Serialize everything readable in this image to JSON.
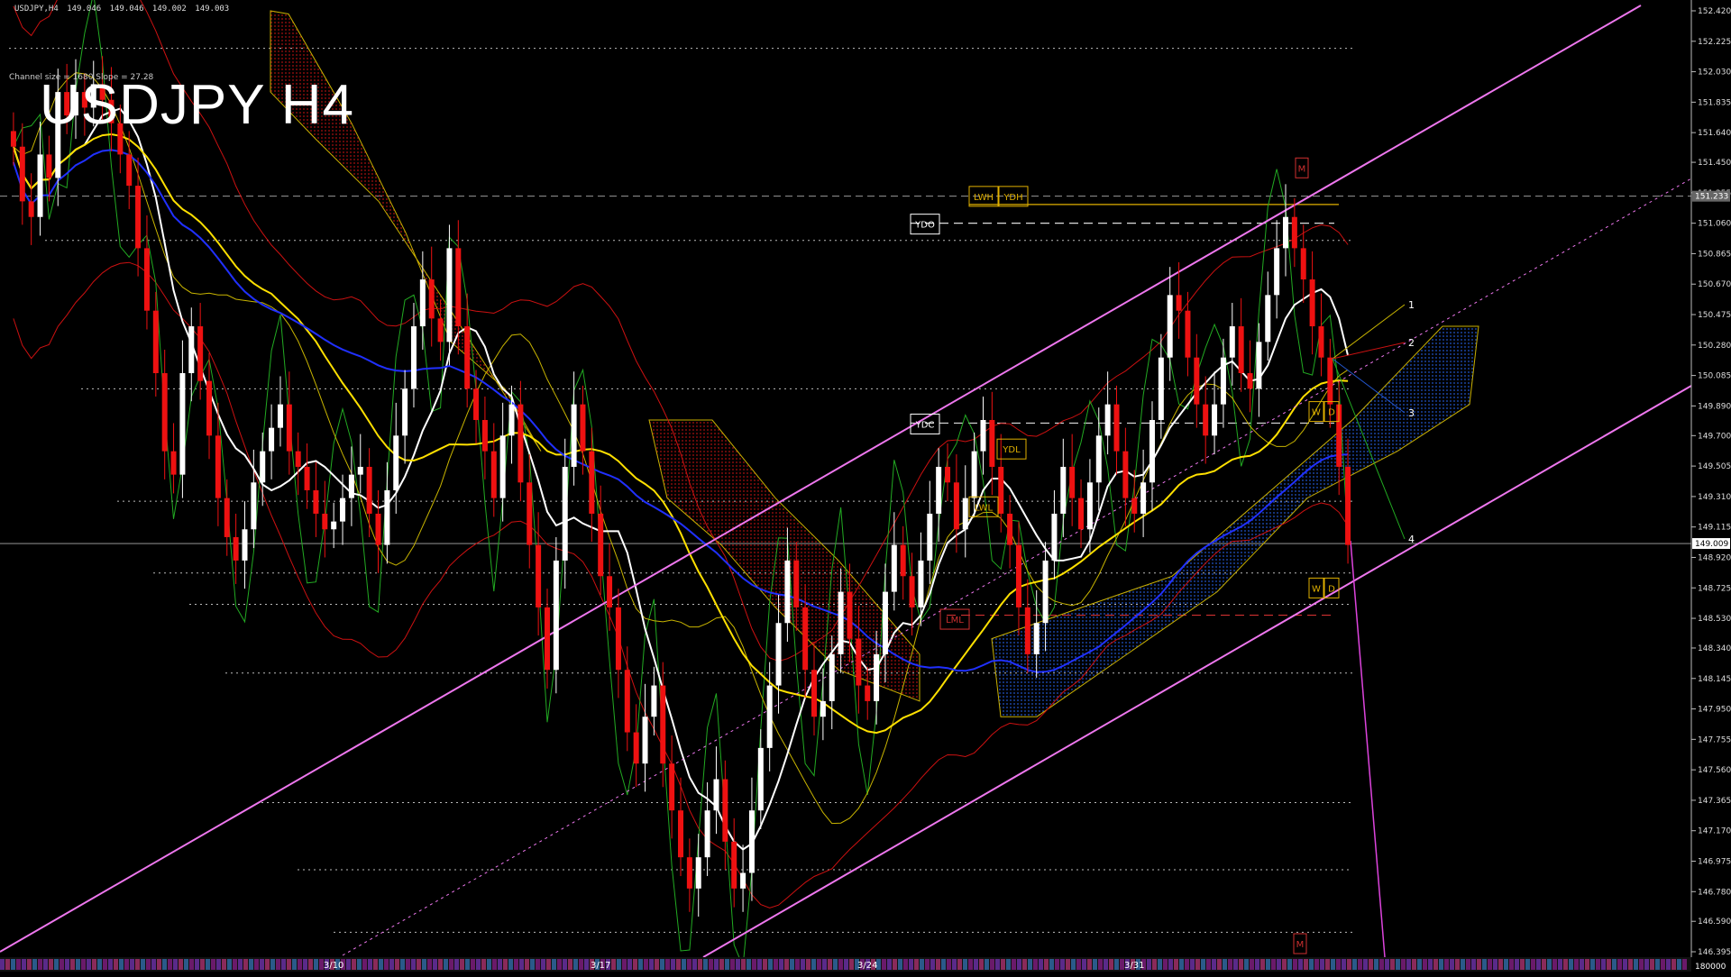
{
  "chart_data": {
    "type": "candlestick",
    "symbol": "USDJPY,H4",
    "title": "USDJPY H4",
    "ohlc_header": {
      "open": "149.046",
      "high": "149.046",
      "low": "149.002",
      "close": "149.003"
    },
    "channel_info": "Channel size = 1680 Slope = 27.28",
    "current_price": "149.009",
    "marked_price": "151.233",
    "ylim": [
      146.395,
      152.42
    ],
    "y_ticks": [
      "152.420",
      "152.225",
      "152.030",
      "151.835",
      "151.640",
      "151.450",
      "151.255",
      "151.060",
      "150.865",
      "150.670",
      "150.475",
      "150.280",
      "150.085",
      "149.890",
      "149.700",
      "149.505",
      "149.310",
      "149.115",
      "148.920",
      "148.725",
      "148.530",
      "148.340",
      "148.145",
      "147.950",
      "147.755",
      "147.560",
      "147.365",
      "147.170",
      "146.975",
      "146.780",
      "146.590",
      "146.395"
    ],
    "x_labels": [
      {
        "label": "3/10",
        "index": 36
      },
      {
        "label": "3/17",
        "index": 66
      },
      {
        "label": "3/24",
        "index": 96
      },
      {
        "label": "3/31",
        "index": 126
      }
    ],
    "bottom_right_label": "180000",
    "annotations": [
      "LWH",
      "YDH",
      "YDO",
      "YDC",
      "YDL",
      "LWL",
      "LML",
      "W",
      "D",
      "M",
      "W",
      "D",
      "M"
    ],
    "fan_labels": [
      "1",
      "2",
      "3",
      "4"
    ],
    "closes": [
      151.55,
      151.2,
      151.1,
      151.5,
      151.35,
      151.9,
      151.75,
      151.9,
      151.8,
      151.95,
      151.85,
      151.7,
      151.5,
      151.3,
      150.9,
      150.5,
      150.1,
      149.6,
      149.45,
      150.1,
      150.4,
      150.05,
      149.7,
      149.3,
      149.05,
      148.9,
      149.1,
      149.4,
      149.6,
      149.75,
      149.9,
      149.6,
      149.5,
      149.35,
      149.2,
      149.1,
      149.15,
      149.3,
      149.45,
      149.5,
      149.2,
      149.0,
      149.35,
      149.7,
      150.0,
      150.4,
      150.7,
      150.45,
      150.3,
      150.9,
      150.4,
      150.0,
      149.8,
      149.6,
      149.3,
      149.7,
      149.9,
      149.4,
      149.0,
      148.6,
      148.2,
      148.9,
      149.5,
      149.9,
      149.6,
      149.2,
      148.8,
      148.6,
      148.2,
      147.8,
      147.6,
      147.9,
      148.1,
      147.6,
      147.3,
      147.0,
      146.8,
      147.0,
      147.3,
      147.5,
      147.1,
      146.8,
      146.9,
      147.3,
      147.7,
      148.1,
      148.5,
      148.9,
      148.6,
      148.2,
      147.9,
      148.0,
      148.3,
      148.7,
      148.4,
      148.1,
      148.0,
      148.3,
      148.7,
      149.0,
      148.8,
      148.6,
      148.9,
      149.2,
      149.5,
      149.4,
      149.1,
      149.3,
      149.6,
      149.8,
      149.5,
      149.2,
      149.0,
      148.6,
      148.3,
      148.5,
      148.9,
      149.2,
      149.5,
      149.3,
      149.1,
      149.4,
      149.7,
      149.9,
      149.6,
      149.3,
      149.2,
      149.4,
      149.8,
      150.2,
      150.6,
      150.5,
      150.2,
      149.9,
      149.7,
      149.9,
      150.2,
      150.4,
      150.1,
      150.0,
      150.3,
      150.6,
      150.9,
      151.1,
      150.9,
      150.7,
      150.4,
      150.2,
      149.9,
      149.5,
      149.0
    ]
  }
}
